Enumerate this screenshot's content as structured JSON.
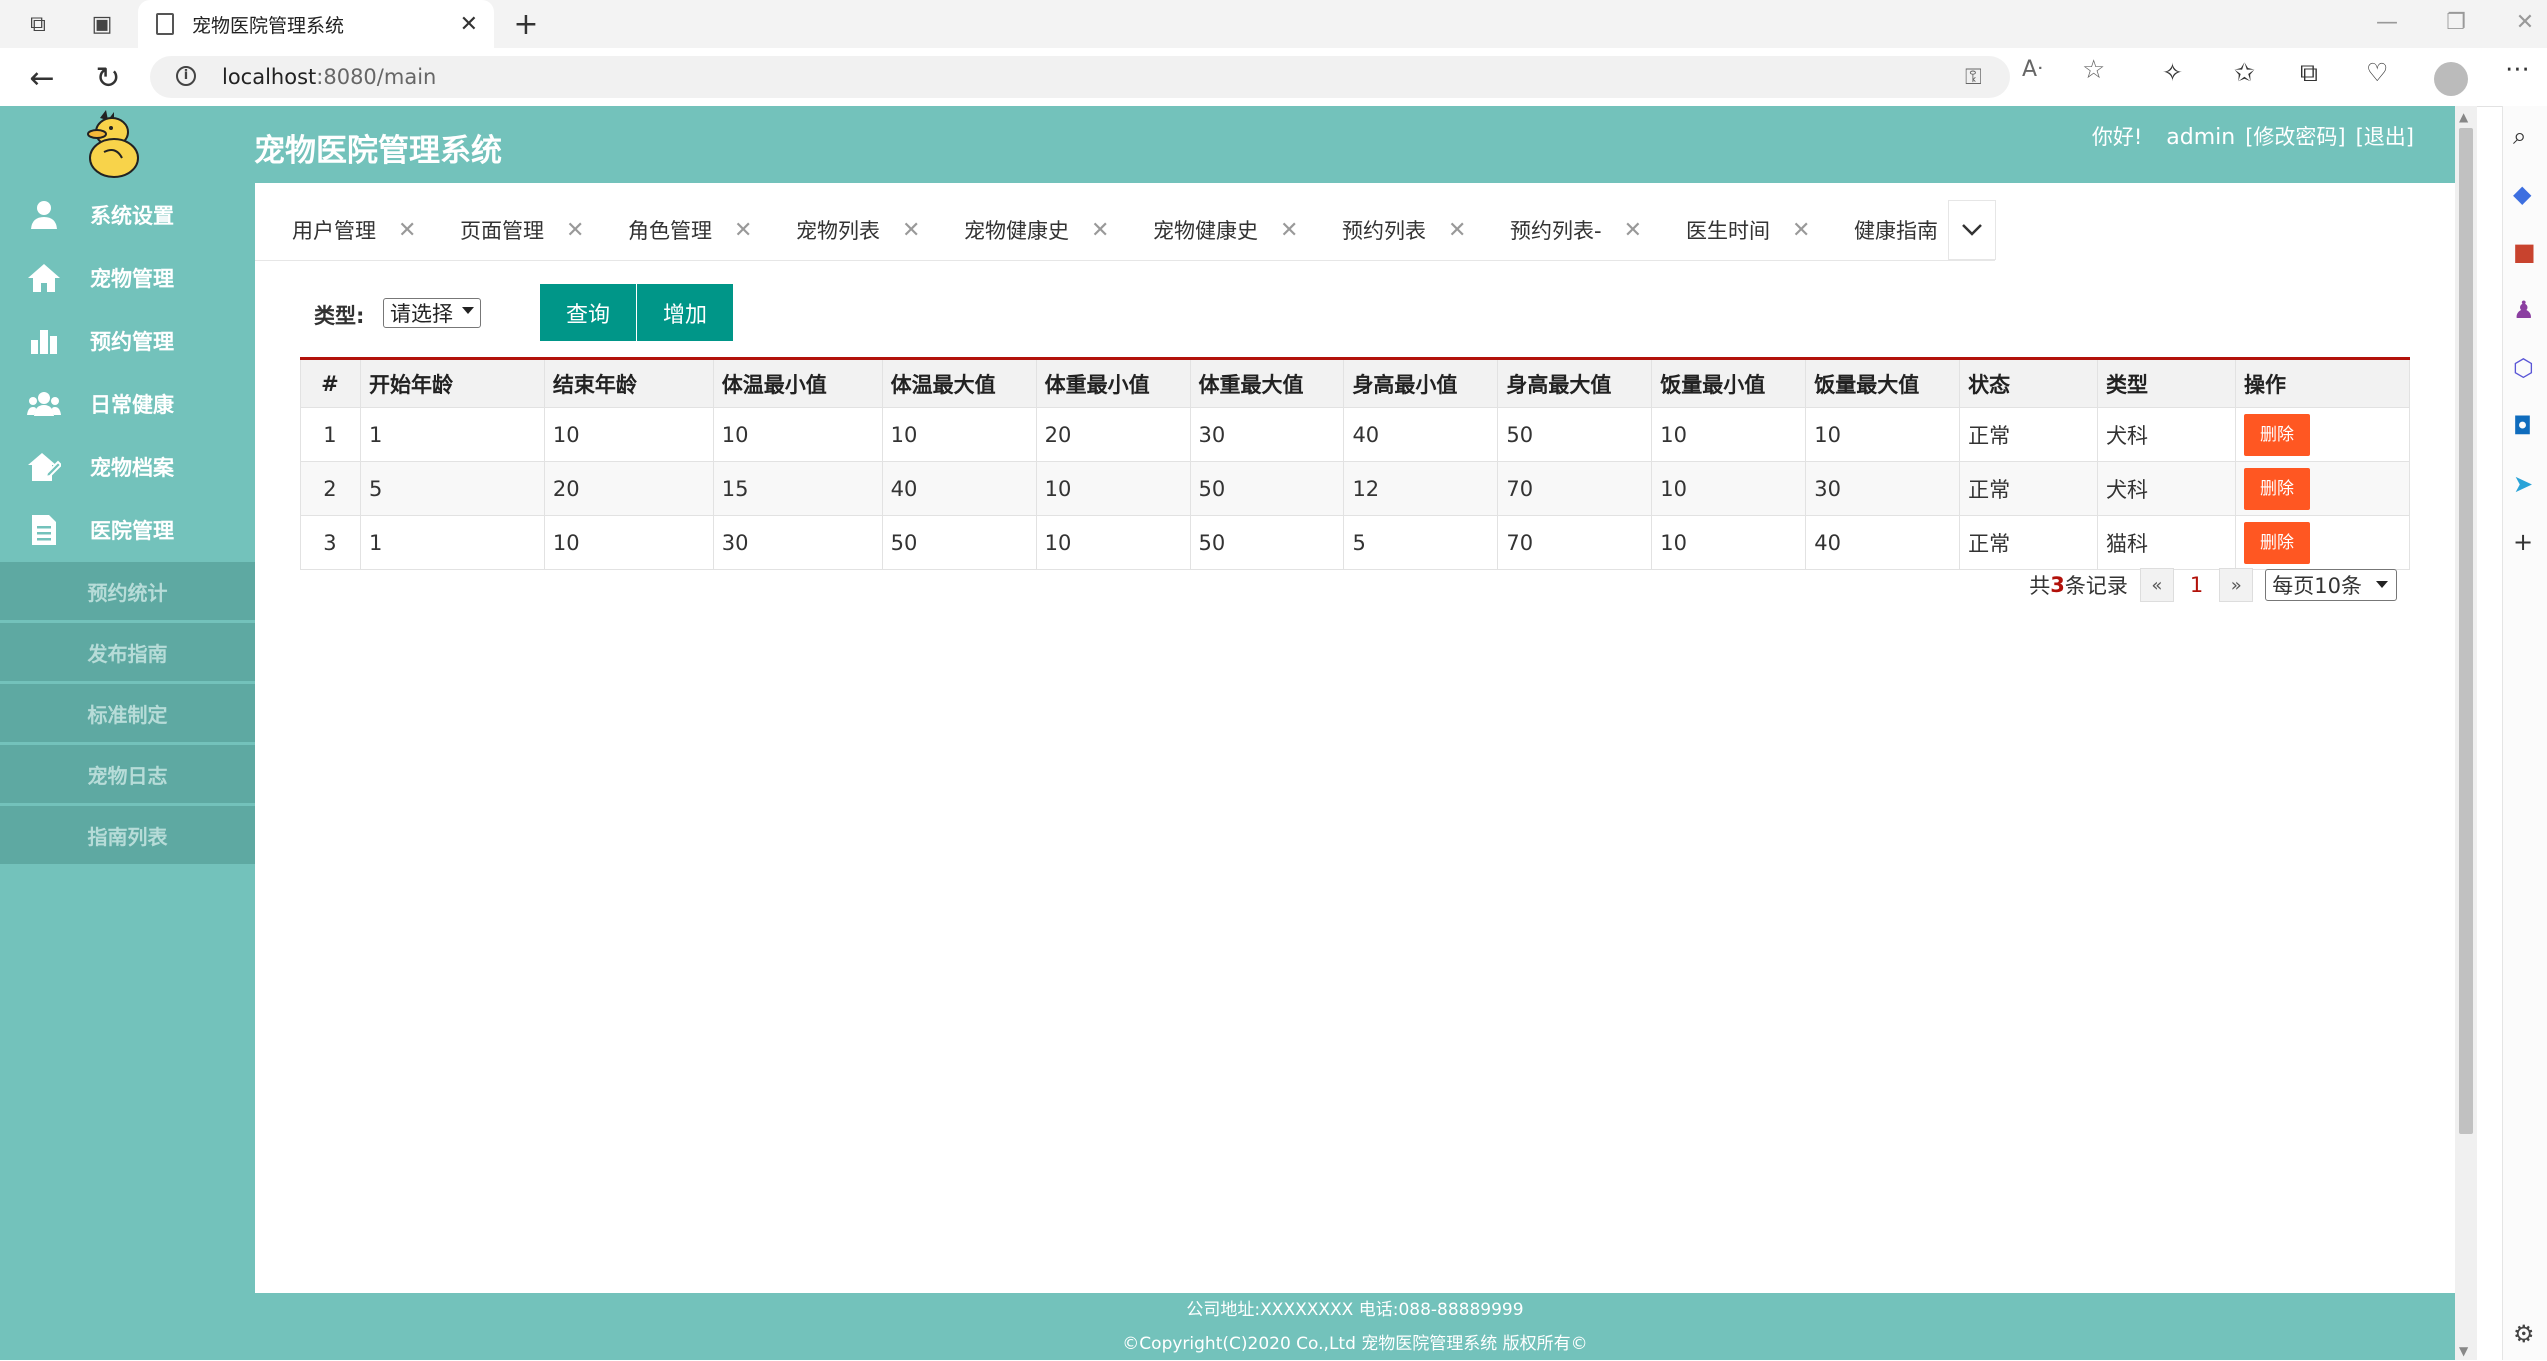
{
  "browser": {
    "tab_title": "宠物医院管理系统",
    "url_host": "localhost",
    "url_port": ":8080",
    "url_path": "/main"
  },
  "app": {
    "title": "宠物医院管理系统",
    "greeting": "你好!",
    "username": "admin",
    "change_password": "[修改密码]",
    "logout": "[退出]"
  },
  "sidebar": {
    "items": [
      {
        "label": "系统设置",
        "icon": "user-icon"
      },
      {
        "label": "宠物管理",
        "icon": "home-icon"
      },
      {
        "label": "预约管理",
        "icon": "bar-chart-icon"
      },
      {
        "label": "日常健康",
        "icon": "users-icon"
      },
      {
        "label": "宠物档案",
        "icon": "house-edit-icon"
      },
      {
        "label": "医院管理",
        "icon": "document-icon"
      }
    ],
    "subitems": [
      "预约统计",
      "发布指南",
      "标准制定",
      "宠物日志",
      "指南列表"
    ]
  },
  "tabs": [
    "用户管理",
    "页面管理",
    "角色管理",
    "宠物列表",
    "宠物健康史",
    "宠物健康史",
    "预约列表",
    "预约列表-",
    "医生时间",
    "健康指南"
  ],
  "filter": {
    "type_label": "类型:",
    "type_value": "请选择",
    "query_button": "查询",
    "add_button": "增加"
  },
  "table": {
    "headers": [
      "#",
      "开始年龄",
      "结束年龄",
      "体温最小值",
      "体温最大值",
      "体重最小值",
      "体重最大值",
      "身高最小值",
      "身高最大值",
      "饭量最小值",
      "饭量最大值",
      "状态",
      "类型",
      "操作"
    ],
    "rows": [
      [
        "1",
        "1",
        "10",
        "10",
        "10",
        "20",
        "30",
        "40",
        "50",
        "10",
        "10",
        "正常",
        "犬科"
      ],
      [
        "2",
        "5",
        "20",
        "15",
        "40",
        "10",
        "50",
        "12",
        "70",
        "10",
        "30",
        "正常",
        "犬科"
      ],
      [
        "3",
        "1",
        "10",
        "30",
        "50",
        "10",
        "50",
        "5",
        "70",
        "10",
        "40",
        "正常",
        "猫科"
      ]
    ],
    "delete_label": "删除"
  },
  "pager": {
    "prefix": "共",
    "count": "3",
    "suffix": "条记录",
    "prev": "«",
    "current": "1",
    "next": "»",
    "page_size": "每页10条"
  },
  "footer": {
    "line1": "公司地址:XXXXXXXX 电话:088-88889999",
    "line2": "©Copyright(C)2020 Co.,Ltd 宠物医院管理系统 版权所有©"
  },
  "colors": {
    "theme": "#73c2bb",
    "button": "#009688",
    "delete": "#ff5722",
    "accent_line": "#b2110a"
  }
}
